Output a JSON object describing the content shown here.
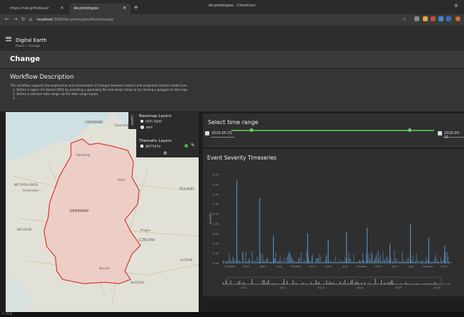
{
  "browser": {
    "window_title": "de-prototypes - Chromium",
    "tabs": [
      {
        "label": "https://raw.githubuser",
        "active": false
      },
      {
        "label": "de-prototypes",
        "active": true
      }
    ],
    "url_host": "localhost",
    "url_path": ":3000/de-prototypes/flood/change"
  },
  "app": {
    "title": "Digital Earth",
    "breadcrumb": "flood > change",
    "page_title": "Change"
  },
  "workflow": {
    "title": "Workflow Description",
    "lines": [
      "This workflow supports the exploration and assessment of changes between historic and projected climate model runs.",
      "1. Define a region of interest (ROI) by providing a geometry file (via drag'n'drop) or by clicking a polygon on the map.",
      "2. Define a relevant date range via the date range inputs.",
      "3. ..."
    ]
  },
  "layers": {
    "tab_label": "Layers",
    "basemap_title": "Basemap Layers",
    "basemaps": [
      "osm layer",
      "esri"
    ],
    "thematic_title": "Thematic Layers",
    "thematic": [
      "germany"
    ]
  },
  "map_labels": {
    "denmark": "DENMARK",
    "copenhagen": "Copenhagen",
    "netherlands": "NETHERLANDS",
    "amsterdam": "Amsterdam",
    "germany": "GERMANY",
    "poland": "POLAND",
    "belgium": "BELGIUM",
    "czechia": "CZECHIA",
    "austria": "AUSTRIA",
    "slovakia": "SLOVAK",
    "hamburg": "Hamburg",
    "berlin": "Berlin",
    "prague": "Prague",
    "munich": "Munich"
  },
  "time_range": {
    "title": "Select time range",
    "start": "2010-05-01",
    "end": "2016-05-01",
    "start_fraction": 0.1,
    "end_fraction": 0.88
  },
  "timeseries": {
    "title": "Event Severity Timeseries",
    "axis_label": "severity",
    "accent": "#5b9bd5"
  },
  "chart_data": {
    "type": "bar",
    "title": "Event Severity Timeseries",
    "ylabel": "severity",
    "ylim": [
      0,
      0.45
    ],
    "yticks": [
      "0.00",
      "0.05",
      "0.10",
      "0.15",
      "0.20",
      "0.25",
      "0.30",
      "0.35",
      "0.40",
      "0.45"
    ],
    "xticks": [
      "October",
      "2012",
      "April",
      "July",
      "October",
      "2013",
      "April",
      "July",
      "October",
      "2014",
      "April",
      "July",
      "October",
      "2015"
    ],
    "overview_ticks": [
      "2011",
      "2012",
      "2013",
      "2014",
      "2015",
      "2016"
    ],
    "peaks": [
      {
        "x": 0.06,
        "value": 0.42
      },
      {
        "x": 0.16,
        "value": 0.33
      },
      {
        "x": 0.22,
        "value": 0.14
      },
      {
        "x": 0.37,
        "value": 0.15
      },
      {
        "x": 0.46,
        "value": 0.12
      },
      {
        "x": 0.54,
        "value": 0.16
      },
      {
        "x": 0.63,
        "value": 0.18
      },
      {
        "x": 0.73,
        "value": 0.1
      },
      {
        "x": 0.82,
        "value": 0.2
      },
      {
        "x": 0.9,
        "value": 0.13
      },
      {
        "x": 0.97,
        "value": 0.09
      }
    ]
  },
  "footer": {
    "text": "© 2020"
  }
}
